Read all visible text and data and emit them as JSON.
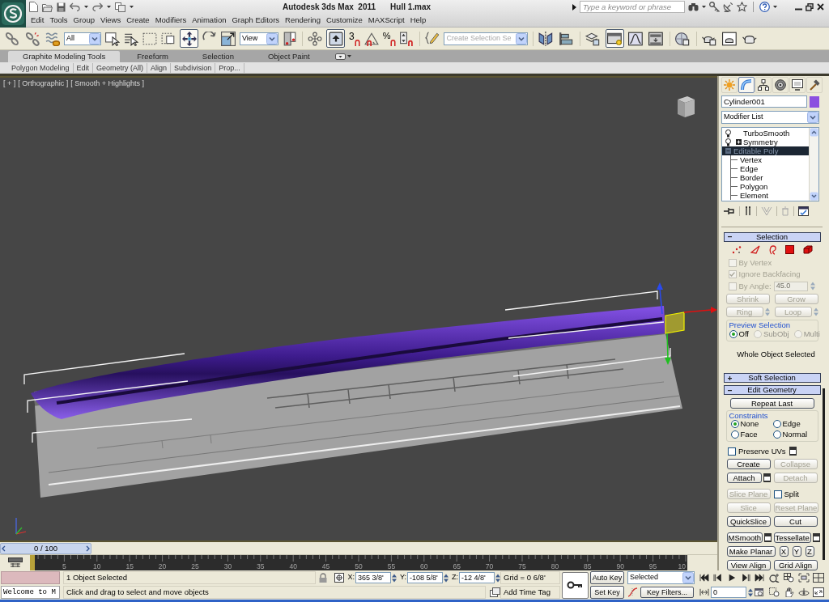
{
  "title_bar": {
    "app_title": "Autodesk 3ds Max  2011",
    "file_name": "Hull 1.max",
    "search": {
      "placeholder": "Type a keyword or phrase"
    }
  },
  "menu": [
    "Edit",
    "Tools",
    "Group",
    "Views",
    "Create",
    "Modifiers",
    "Animation",
    "Graph Editors",
    "Rendering",
    "Customize",
    "MAXScript",
    "Help"
  ],
  "main_toolbar": {
    "selection_filter": "All",
    "reference_coordinate_system": "View",
    "snap_glyph": "3",
    "percent_snap_glyph": "%",
    "named_selection": {
      "placeholder": "Create Selection Se"
    },
    "move_tool_on": true,
    "shortcut_override_on": true,
    "graphite_toggle_on": true
  },
  "ribbon": {
    "tabs": [
      {
        "label": "Graphite Modeling Tools",
        "selected": true
      },
      {
        "label": "Freeform",
        "selected": false
      },
      {
        "label": "Selection",
        "selected": false
      },
      {
        "label": "Object Paint",
        "selected": false
      }
    ],
    "panels": [
      "Polygon Modeling",
      "Edit",
      "Geometry (All)",
      "Align",
      "Subdivision",
      "Prop..."
    ]
  },
  "viewport": {
    "labels": [
      "[ + ]",
      "[ Orthographic ]",
      "[ Smooth + Highlights ]"
    ]
  },
  "command_panel": {
    "tabs": [
      {
        "selected": false
      },
      {
        "selected": true
      },
      {
        "selected": false
      },
      {
        "selected": false
      },
      {
        "selected": false
      },
      {
        "selected": false
      }
    ],
    "object": {
      "name": "Cylinder001",
      "color": "#8b4fe0"
    },
    "modifier_list": "Modifier List",
    "modifier_stack": [
      {
        "name": "TurboSmooth",
        "selected": false,
        "on": true
      },
      {
        "name": "Symmetry",
        "selected": false,
        "on": true,
        "expanded": false
      },
      {
        "name": "Editable Poly",
        "selected": true,
        "expanded": true,
        "children": [
          {
            "name": "Vertex",
            "selected": false
          },
          {
            "name": "Edge",
            "selected": false
          },
          {
            "name": "Border",
            "selected": false
          },
          {
            "name": "Polygon",
            "selected": false
          },
          {
            "name": "Element",
            "selected": false
          }
        ]
      }
    ],
    "stack_tools": [
      {
        "disabled": false
      },
      {
        "disabled": false
      },
      {
        "disabled": true
      },
      {
        "disabled": true
      },
      {
        "disabled": false
      }
    ],
    "selection": {
      "title": "Selection",
      "expanded": true,
      "levels": [
        {
          "selected": false
        },
        {
          "selected": false
        },
        {
          "selected": false
        },
        {
          "selected": false
        },
        {
          "selected": false
        }
      ],
      "checks": [
        {
          "label": "By Vertex",
          "checked": false,
          "disabled": true
        },
        {
          "label": "Ignore Backfacing",
          "checked": true,
          "disabled": true
        }
      ],
      "by_angle": {
        "label": "By Angle:",
        "checked": false,
        "disabled": true,
        "value": "45.0"
      },
      "buttons": [
        {
          "label": "Shrink",
          "disabled": true
        },
        {
          "label": "Grow",
          "disabled": true
        },
        {
          "label": "Ring",
          "disabled": true,
          "spinner": true
        },
        {
          "label": "Loop",
          "disabled": true,
          "spinner": true
        }
      ],
      "preview": {
        "title": "Preview Selection",
        "options": [
          {
            "label": "Off",
            "selected": true,
            "disabled": false
          },
          {
            "label": "SubObj",
            "selected": false,
            "disabled": true
          },
          {
            "label": "Multi",
            "selected": false,
            "disabled": true
          }
        ]
      },
      "status": "Whole Object Selected"
    },
    "soft_selection": {
      "title": "Soft Selection",
      "expanded": false
    },
    "edit_geometry": {
      "title": "Edit Geometry",
      "expanded": true,
      "repeat_last": {
        "label": "Repeat Last",
        "disabled": false
      },
      "constraints": {
        "title": "Constraints",
        "options": [
          {
            "label": "None",
            "selected": true
          },
          {
            "label": "Edge",
            "selected": false
          },
          {
            "label": "Face",
            "selected": false
          },
          {
            "label": "Normal",
            "selected": false
          }
        ]
      },
      "preserve_uvs": {
        "label": "Preserve UVs",
        "checked": false,
        "settings": true
      },
      "rows": [
        [
          {
            "kind": "button",
            "label": "Create",
            "disabled": false
          },
          {
            "kind": "button",
            "label": "Collapse",
            "disabled": true
          }
        ],
        [
          {
            "kind": "button",
            "label": "Attach",
            "disabled": false,
            "settings": true
          },
          {
            "kind": "button",
            "label": "Detach",
            "disabled": true
          }
        ],
        [
          {
            "kind": "button",
            "label": "Slice Plane",
            "disabled": true
          },
          {
            "kind": "checkbox",
            "label": "Split",
            "checked": false
          }
        ],
        [
          {
            "kind": "button",
            "label": "Slice",
            "disabled": true
          },
          {
            "kind": "button",
            "label": "Reset Plane",
            "disabled": true
          }
        ],
        [
          {
            "kind": "button",
            "label": "QuickSlice",
            "disabled": false
          },
          {
            "kind": "button",
            "label": "Cut",
            "disabled": false
          }
        ],
        [
          {
            "kind": "button",
            "label": "MSmooth",
            "disabled": false,
            "settings": true
          },
          {
            "kind": "button",
            "label": "Tessellate",
            "disabled": false,
            "settings": true
          }
        ],
        [
          {
            "kind": "button",
            "label": "Make Planar",
            "disabled": false
          },
          {
            "kind": "axis",
            "label": "X"
          },
          {
            "kind": "axis",
            "label": "Y"
          },
          {
            "kind": "axis",
            "label": "Z"
          }
        ],
        [
          {
            "kind": "button",
            "label": "View Align",
            "disabled": false
          },
          {
            "kind": "button",
            "label": "Grid Align",
            "disabled": false
          }
        ]
      ]
    }
  },
  "time_slider": {
    "label": "0 / 100",
    "level": 0
  },
  "track_bar": {
    "labels": [
      "5",
      "10",
      "15",
      "20",
      "25",
      "30",
      "35",
      "40",
      "45",
      "50",
      "55",
      "60",
      "65",
      "70",
      "75",
      "80",
      "85",
      "90",
      "95",
      "10"
    ]
  },
  "status_bar": {
    "listener": {
      "value": "Welcome to M"
    },
    "prompt": "1 Object Selected",
    "hint": "Click and drag to select and move objects",
    "coords": [
      {
        "axis": "X:",
        "value": "365 3/8'"
      },
      {
        "axis": "Y:",
        "value": "-108 5/8'"
      },
      {
        "axis": "Z:",
        "value": "-12 4/8'"
      }
    ],
    "grid": "Grid = 0 6/8'",
    "time_tag": "Add Time Tag",
    "auto_key": {
      "label": "Auto Key",
      "on": false
    },
    "set_key": "Set Key",
    "key_mode": "Selected",
    "key_filters": "Key Filters...",
    "frame": "0"
  }
}
